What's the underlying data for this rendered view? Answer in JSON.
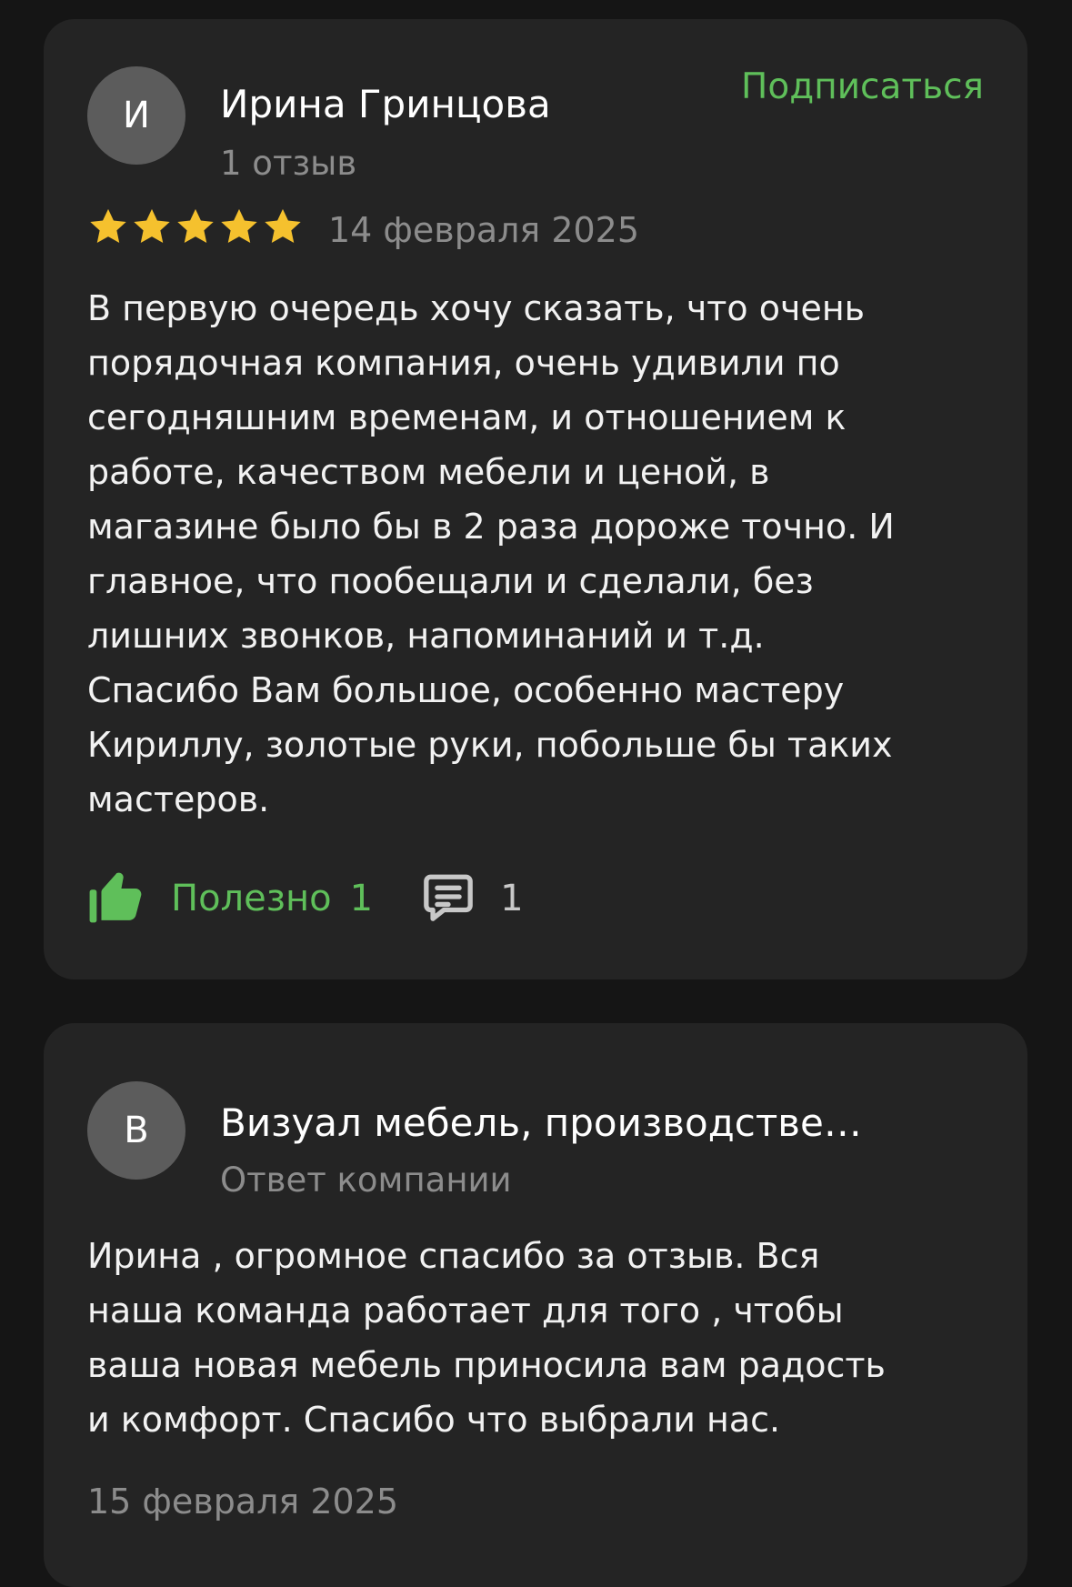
{
  "review": {
    "avatar_letter": "И",
    "author_name": "Ирина Гринцова",
    "author_reviews": "1 отзыв",
    "subscribe_label": "Подписаться",
    "rating": 5,
    "rating_max": 5,
    "date": "14 февраля 2025",
    "text": "В первую очередь хочу сказать, что очень\nпорядочная компания, очень удивили по\nсегодняшним временам, и отношением к\nработе, качеством мебели и ценой, в\nмагазине было бы в 2 раза дороже точно. И\nглавное, что пообещали и сделали, без\nлишних звонков, напоминаний и т.д.\nСпасибо Вам большое, особенно мастеру\nКириллу, золотые руки, побольше бы таких\nмастеров.",
    "helpful_label": "Полезно",
    "helpful_count": "1",
    "comments_count": "1"
  },
  "reply": {
    "avatar_letter": "В",
    "company_name": "Визуал мебель, производстве…",
    "subtitle": "Ответ компании",
    "text": "Ирина , огромное спасибо за отзыв. Вся\nнаша команда работает для того , чтобы\nваша новая мебель приносила вам радость\nи комфорт. Спасибо что выбрали нас.",
    "date": "15 февраля 2025"
  },
  "colors": {
    "accent_green": "#5fbf5a",
    "star_yellow": "#f5c12e",
    "card_bg": "#242424",
    "page_bg": "#151515"
  },
  "icons": {
    "star": "star-icon",
    "thumbs_up": "thumbs-up-icon",
    "comment": "comment-icon"
  }
}
